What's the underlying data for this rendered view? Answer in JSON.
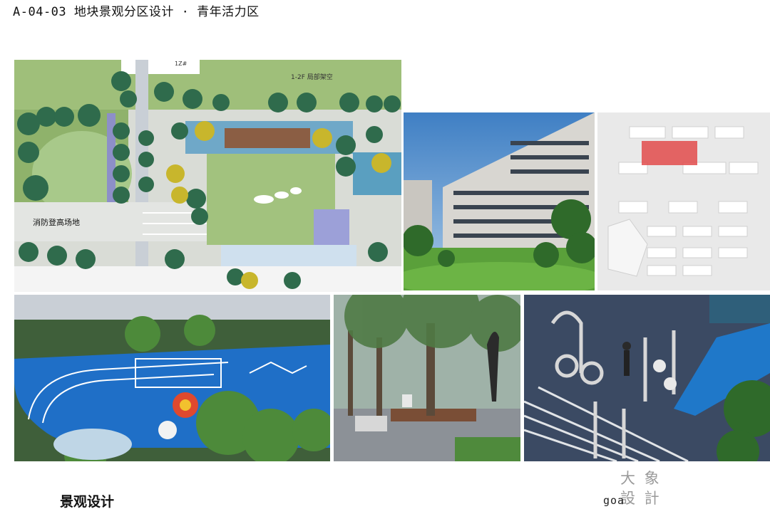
{
  "header": {
    "title": "A-04-03 地块景观分区设计 · 青年活力区"
  },
  "site_plan": {
    "labels": {
      "building_tag": "1Z#",
      "overhead": "1-2F 局部架空",
      "fire_area": "消防登高场地"
    }
  },
  "footer": {
    "left_label": "景观设计",
    "logo_latin": "goa",
    "logo_cn_1": "大 象",
    "logo_cn_2": "設 計"
  }
}
